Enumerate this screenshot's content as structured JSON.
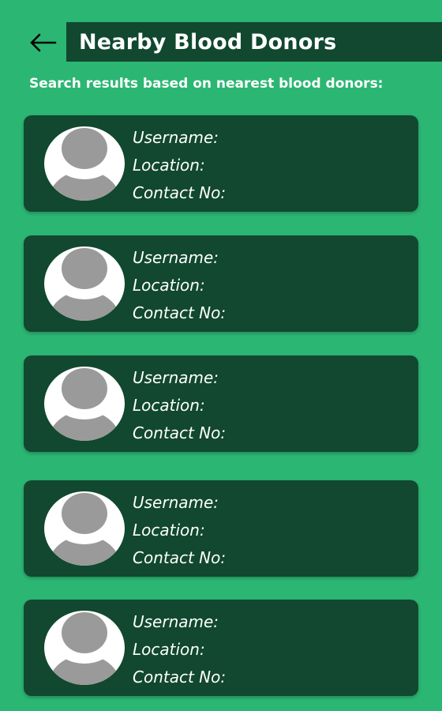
{
  "header": {
    "back_icon": "arrow-left-icon",
    "title": "Nearby Blood Donors"
  },
  "subtitle": "Search results based on nearest blood donors:",
  "colors": {
    "background": "#2cb673",
    "card": "#11482f",
    "avatar_bg": "#ffffff",
    "avatar_fg": "#9a9a9a"
  },
  "donors": [
    {
      "username_label": "Username:",
      "location_label": "Location:",
      "contact_label": "Contact No:"
    },
    {
      "username_label": "Username:",
      "location_label": "Location:",
      "contact_label": "Contact No:"
    },
    {
      "username_label": "Username:",
      "location_label": "Location:",
      "contact_label": "Contact No:"
    },
    {
      "username_label": "Username:",
      "location_label": "Location:",
      "contact_label": "Contact No:"
    },
    {
      "username_label": "Username:",
      "location_label": "Location:",
      "contact_label": "Contact No:"
    }
  ]
}
